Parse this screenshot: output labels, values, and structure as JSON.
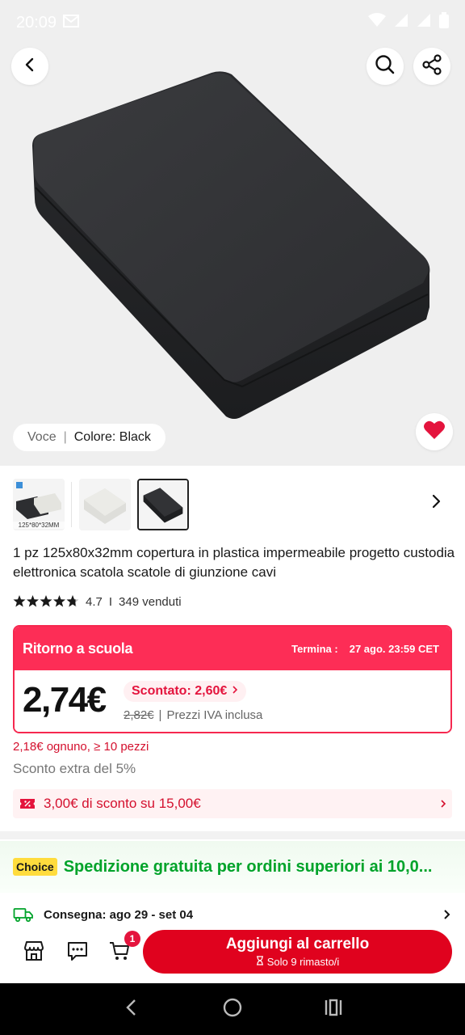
{
  "status_bar": {
    "time": "20:09",
    "mail_icon": "mail-icon",
    "icons": [
      "wifi-icon",
      "signal-icon",
      "signal-icon",
      "battery-icon"
    ]
  },
  "header": {
    "back_icon": "chevron-left-icon",
    "search_icon": "search-icon",
    "share_icon": "share-icon"
  },
  "gallery": {
    "variant_label": "Voce",
    "variant_separator": "|",
    "variant_value": "Colore: Black",
    "favorite_icon": "heart-icon",
    "thumb1_caption": "125*80*32MM",
    "next_icon": "chevron-right-icon"
  },
  "product": {
    "title": "1 pz 125x80x32mm copertura in plastica impermeabile progetto custodia elettronica scatola scatole di giunzione cavi",
    "rating": "4.7",
    "rating_divider": "I",
    "sold": "349 venduti",
    "stars": 4.7
  },
  "promo": {
    "title": "Ritorno a scuola",
    "deadline_label": "Termina :",
    "deadline_value": "27 ago. 23:59 CET",
    "price": "2,74€",
    "discount": "Scontato: 2,60€",
    "old_price": "2,82€",
    "separator": "|",
    "vat_note": "Prezzi IVA inclusa"
  },
  "bulk_price": "2,18€ ognuno, ≥ 10 pezzi",
  "extra_discount": "Sconto extra del 5%",
  "coupon": {
    "icon": "coupon-icon",
    "text": "3,00€ di sconto su 15,00€"
  },
  "shipping": {
    "badge": "Choice",
    "text": "Spedizione gratuita per ordini superiori ai 10,0..."
  },
  "delivery": {
    "icon": "truck-icon",
    "text": "Consegna: ago 29 - set 04"
  },
  "action_bar": {
    "store_icon": "store-icon",
    "chat_icon": "chat-icon",
    "cart_icon": "cart-icon",
    "cart_count": "1",
    "add_to_cart": "Aggiungi al carrello",
    "stock_note": "Solo 9 rimasto/i"
  },
  "nav_bar": {
    "icons": [
      "back-nav-icon",
      "home-nav-icon",
      "recents-nav-icon"
    ]
  },
  "colors": {
    "accent": "#e0021e",
    "promo": "#fd2d56",
    "shipping_green": "#00a32a",
    "choice_yellow": "#ffdc3d"
  }
}
